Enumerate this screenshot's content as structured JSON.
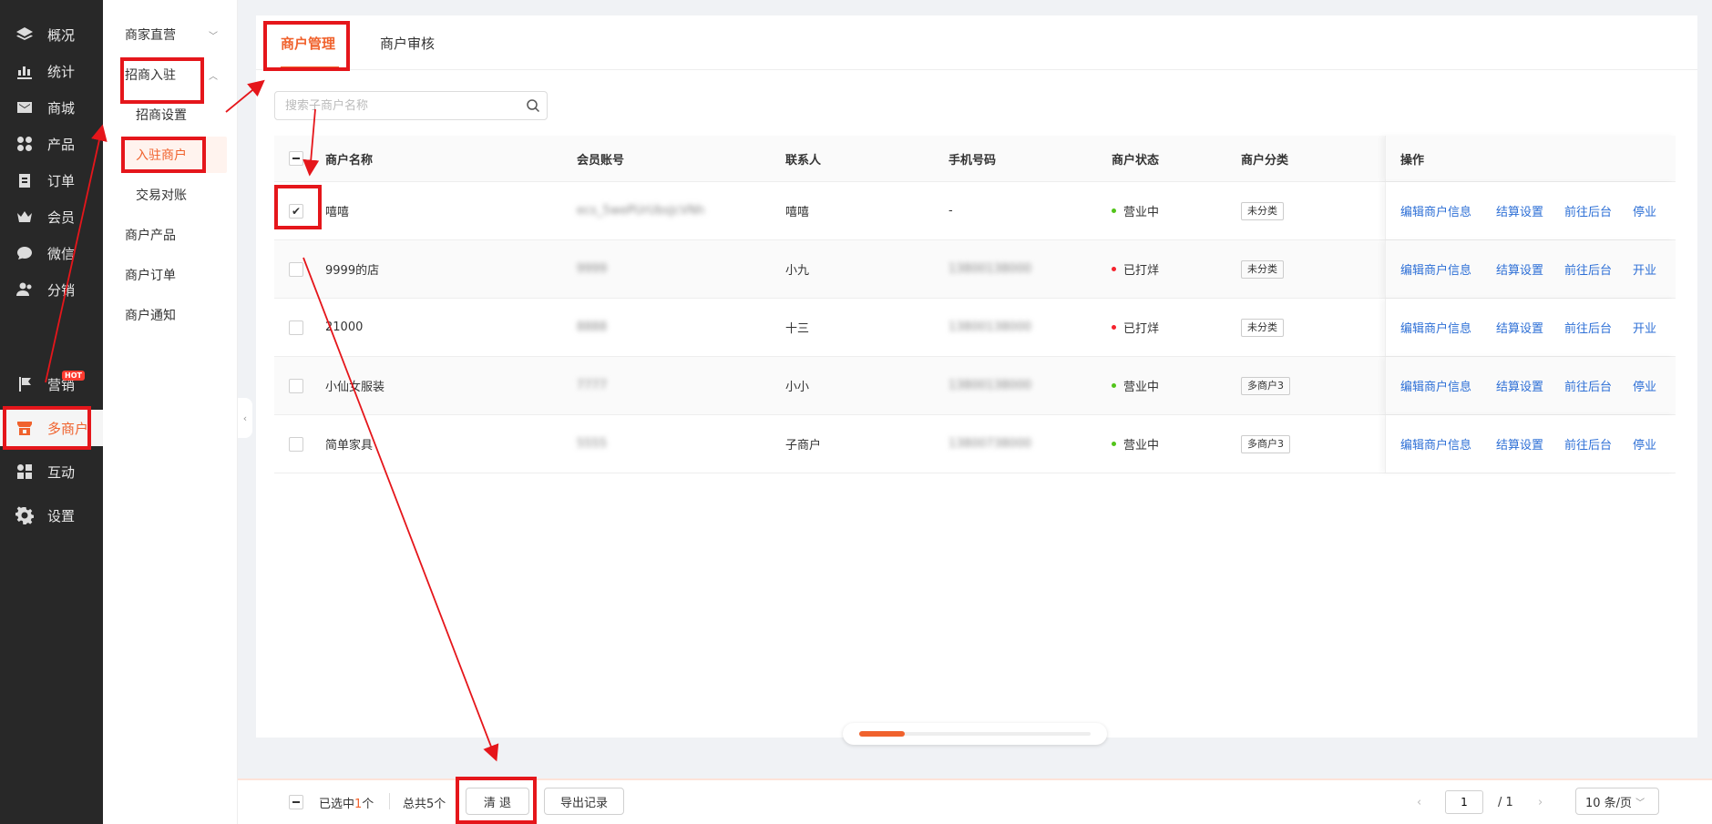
{
  "sidebar": {
    "items": [
      {
        "label": "概况",
        "icon": "layers-icon"
      },
      {
        "label": "统计",
        "icon": "chart-icon"
      },
      {
        "label": "商城",
        "icon": "mail-icon"
      },
      {
        "label": "产品",
        "icon": "grid-icon"
      },
      {
        "label": "订单",
        "icon": "clipboard-icon"
      },
      {
        "label": "会员",
        "icon": "crown-icon"
      },
      {
        "label": "微信",
        "icon": "chat-icon"
      },
      {
        "label": "分销",
        "icon": "users-icon"
      },
      {
        "label": "营销",
        "icon": "flag-icon",
        "badge": "HOT"
      },
      {
        "label": "多商户",
        "icon": "store-icon"
      },
      {
        "label": "互动",
        "icon": "apps-icon"
      },
      {
        "label": "设置",
        "icon": "gear-icon"
      }
    ]
  },
  "subnav": {
    "items": [
      "商家直营",
      "招商入驻",
      "招商设置",
      "入驻商户",
      "交易对账",
      "商户产品",
      "商户订单",
      "商户通知"
    ]
  },
  "tabs": [
    "商户管理",
    "商户审核"
  ],
  "search": {
    "placeholder": "搜索子商户名称"
  },
  "table": {
    "headers": [
      "商户名称",
      "会员账号",
      "联系人",
      "手机号码",
      "商户状态",
      "商户分类",
      "操作"
    ],
    "rows": [
      {
        "name": "嘻嘻",
        "account": "ecs_5wePUrUbsJcVNh",
        "contact": "嘻嘻",
        "phone": "-",
        "status": "营业中",
        "category": "未分类",
        "actions": [
          "编辑商户信息",
          "结算设置",
          "前往后台",
          "停业"
        ]
      },
      {
        "name": "9999的店",
        "account": "9999",
        "contact": "小九",
        "phone": "13800138000",
        "status": "已打烊",
        "category": "未分类",
        "actions": [
          "编辑商户信息",
          "结算设置",
          "前往后台",
          "开业"
        ]
      },
      {
        "name": "21000",
        "account": "8888",
        "contact": "十三",
        "phone": "13800138000",
        "status": "已打烊",
        "category": "未分类",
        "actions": [
          "编辑商户信息",
          "结算设置",
          "前往后台",
          "开业"
        ]
      },
      {
        "name": "小仙女服装",
        "account": "7777",
        "contact": "小小",
        "phone": "13800138000",
        "status": "营业中",
        "category": "多商户3",
        "actions": [
          "编辑商户信息",
          "结算设置",
          "前往后台",
          "停业"
        ]
      },
      {
        "name": "简单家具",
        "account": "5555",
        "contact": "子商户",
        "phone": "13800738000",
        "status": "营业中",
        "category": "多商户3",
        "actions": [
          "编辑商户信息",
          "结算设置",
          "前往后台",
          "停业"
        ]
      }
    ]
  },
  "footer": {
    "selected_prefix": "已选中",
    "selected_count": "1",
    "selected_suffix": "个",
    "total": "总共5个",
    "clear_label": "清 退",
    "export_label": "导出记录",
    "page_current": "1",
    "page_total": "/ 1",
    "page_size": "10 条/页"
  },
  "colors": {
    "accent": "#f0622d",
    "link": "#2d6fd6",
    "annotation": "#e5161b",
    "status_open": "#52c41a",
    "status_closed": "#f5222d"
  }
}
